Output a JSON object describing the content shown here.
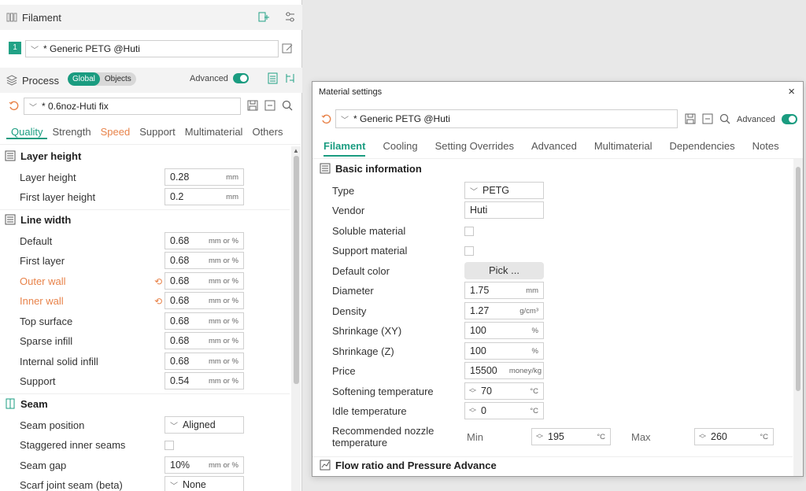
{
  "filament": {
    "title": "Filament",
    "slot": "1",
    "preset": "* Generic PETG @Huti"
  },
  "process": {
    "title": "Process",
    "seg_global": "Global",
    "seg_objects": "Objects",
    "advanced_label": "Advanced",
    "preset": "* 0.6noz-Huti fix",
    "tabs": [
      "Quality",
      "Strength",
      "Speed",
      "Support",
      "Multimaterial",
      "Others"
    ]
  },
  "quality": {
    "layer_height_section": "Layer height",
    "layer_height_label": "Layer height",
    "layer_height_value": "0.28",
    "layer_height_unit": "mm",
    "first_layer_height_label": "First layer height",
    "first_layer_height_value": "0.2",
    "first_layer_height_unit": "mm",
    "line_width_section": "Line width",
    "line_rows": [
      {
        "label": "Default",
        "value": "0.68",
        "unit": "mm or %"
      },
      {
        "label": "First layer",
        "value": "0.68",
        "unit": "mm or %"
      },
      {
        "label": "Outer wall",
        "value": "0.68",
        "unit": "mm or %"
      },
      {
        "label": "Inner wall",
        "value": "0.68",
        "unit": "mm or %"
      },
      {
        "label": "Top surface",
        "value": "0.68",
        "unit": "mm or %"
      },
      {
        "label": "Sparse infill",
        "value": "0.68",
        "unit": "mm or %"
      },
      {
        "label": "Internal solid infill",
        "value": "0.68",
        "unit": "mm or %"
      },
      {
        "label": "Support",
        "value": "0.54",
        "unit": "mm or %"
      }
    ],
    "seam_section": "Seam",
    "seam_position_label": "Seam position",
    "seam_position_value": "Aligned",
    "staggered_label": "Staggered inner seams",
    "seam_gap_label": "Seam gap",
    "seam_gap_value": "10%",
    "seam_gap_unit": "mm or %",
    "scarf_label": "Scarf joint seam (beta)",
    "scarf_value": "None"
  },
  "dialog": {
    "title": "Material settings",
    "close": "×",
    "preset": "* Generic PETG @Huti",
    "advanced_label": "Advanced",
    "tabs": [
      "Filament",
      "Cooling",
      "Setting Overrides",
      "Advanced",
      "Multimaterial",
      "Dependencies",
      "Notes"
    ],
    "basic_section": "Basic information",
    "type_label": "Type",
    "type_value": "PETG",
    "vendor_label": "Vendor",
    "vendor_value": "Huti",
    "soluble_label": "Soluble material",
    "support_label": "Support material",
    "color_label": "Default color",
    "pick_label": "Pick ...",
    "diameter_label": "Diameter",
    "diameter_value": "1.75",
    "diameter_unit": "mm",
    "density_label": "Density",
    "density_value": "1.27",
    "density_unit": "g/cm³",
    "shrink_xy_label": "Shrinkage (XY)",
    "shrink_xy_value": "100",
    "shrink_xy_unit": "%",
    "shrink_z_label": "Shrinkage (Z)",
    "shrink_z_value": "100",
    "shrink_z_unit": "%",
    "price_label": "Price",
    "price_value": "15500",
    "price_unit": "money/kg",
    "softening_label": "Softening temperature",
    "softening_value": "70",
    "softening_unit": "°C",
    "idle_label": "Idle temperature",
    "idle_value": "0",
    "idle_unit": "°C",
    "nozzle_label_1": "Recommended nozzle",
    "nozzle_label_2": "temperature",
    "min_label": "Min",
    "min_value": "195",
    "min_unit": "°C",
    "max_label": "Max",
    "max_value": "260",
    "max_unit": "°C",
    "flow_section": "Flow ratio and Pressure Advance"
  }
}
